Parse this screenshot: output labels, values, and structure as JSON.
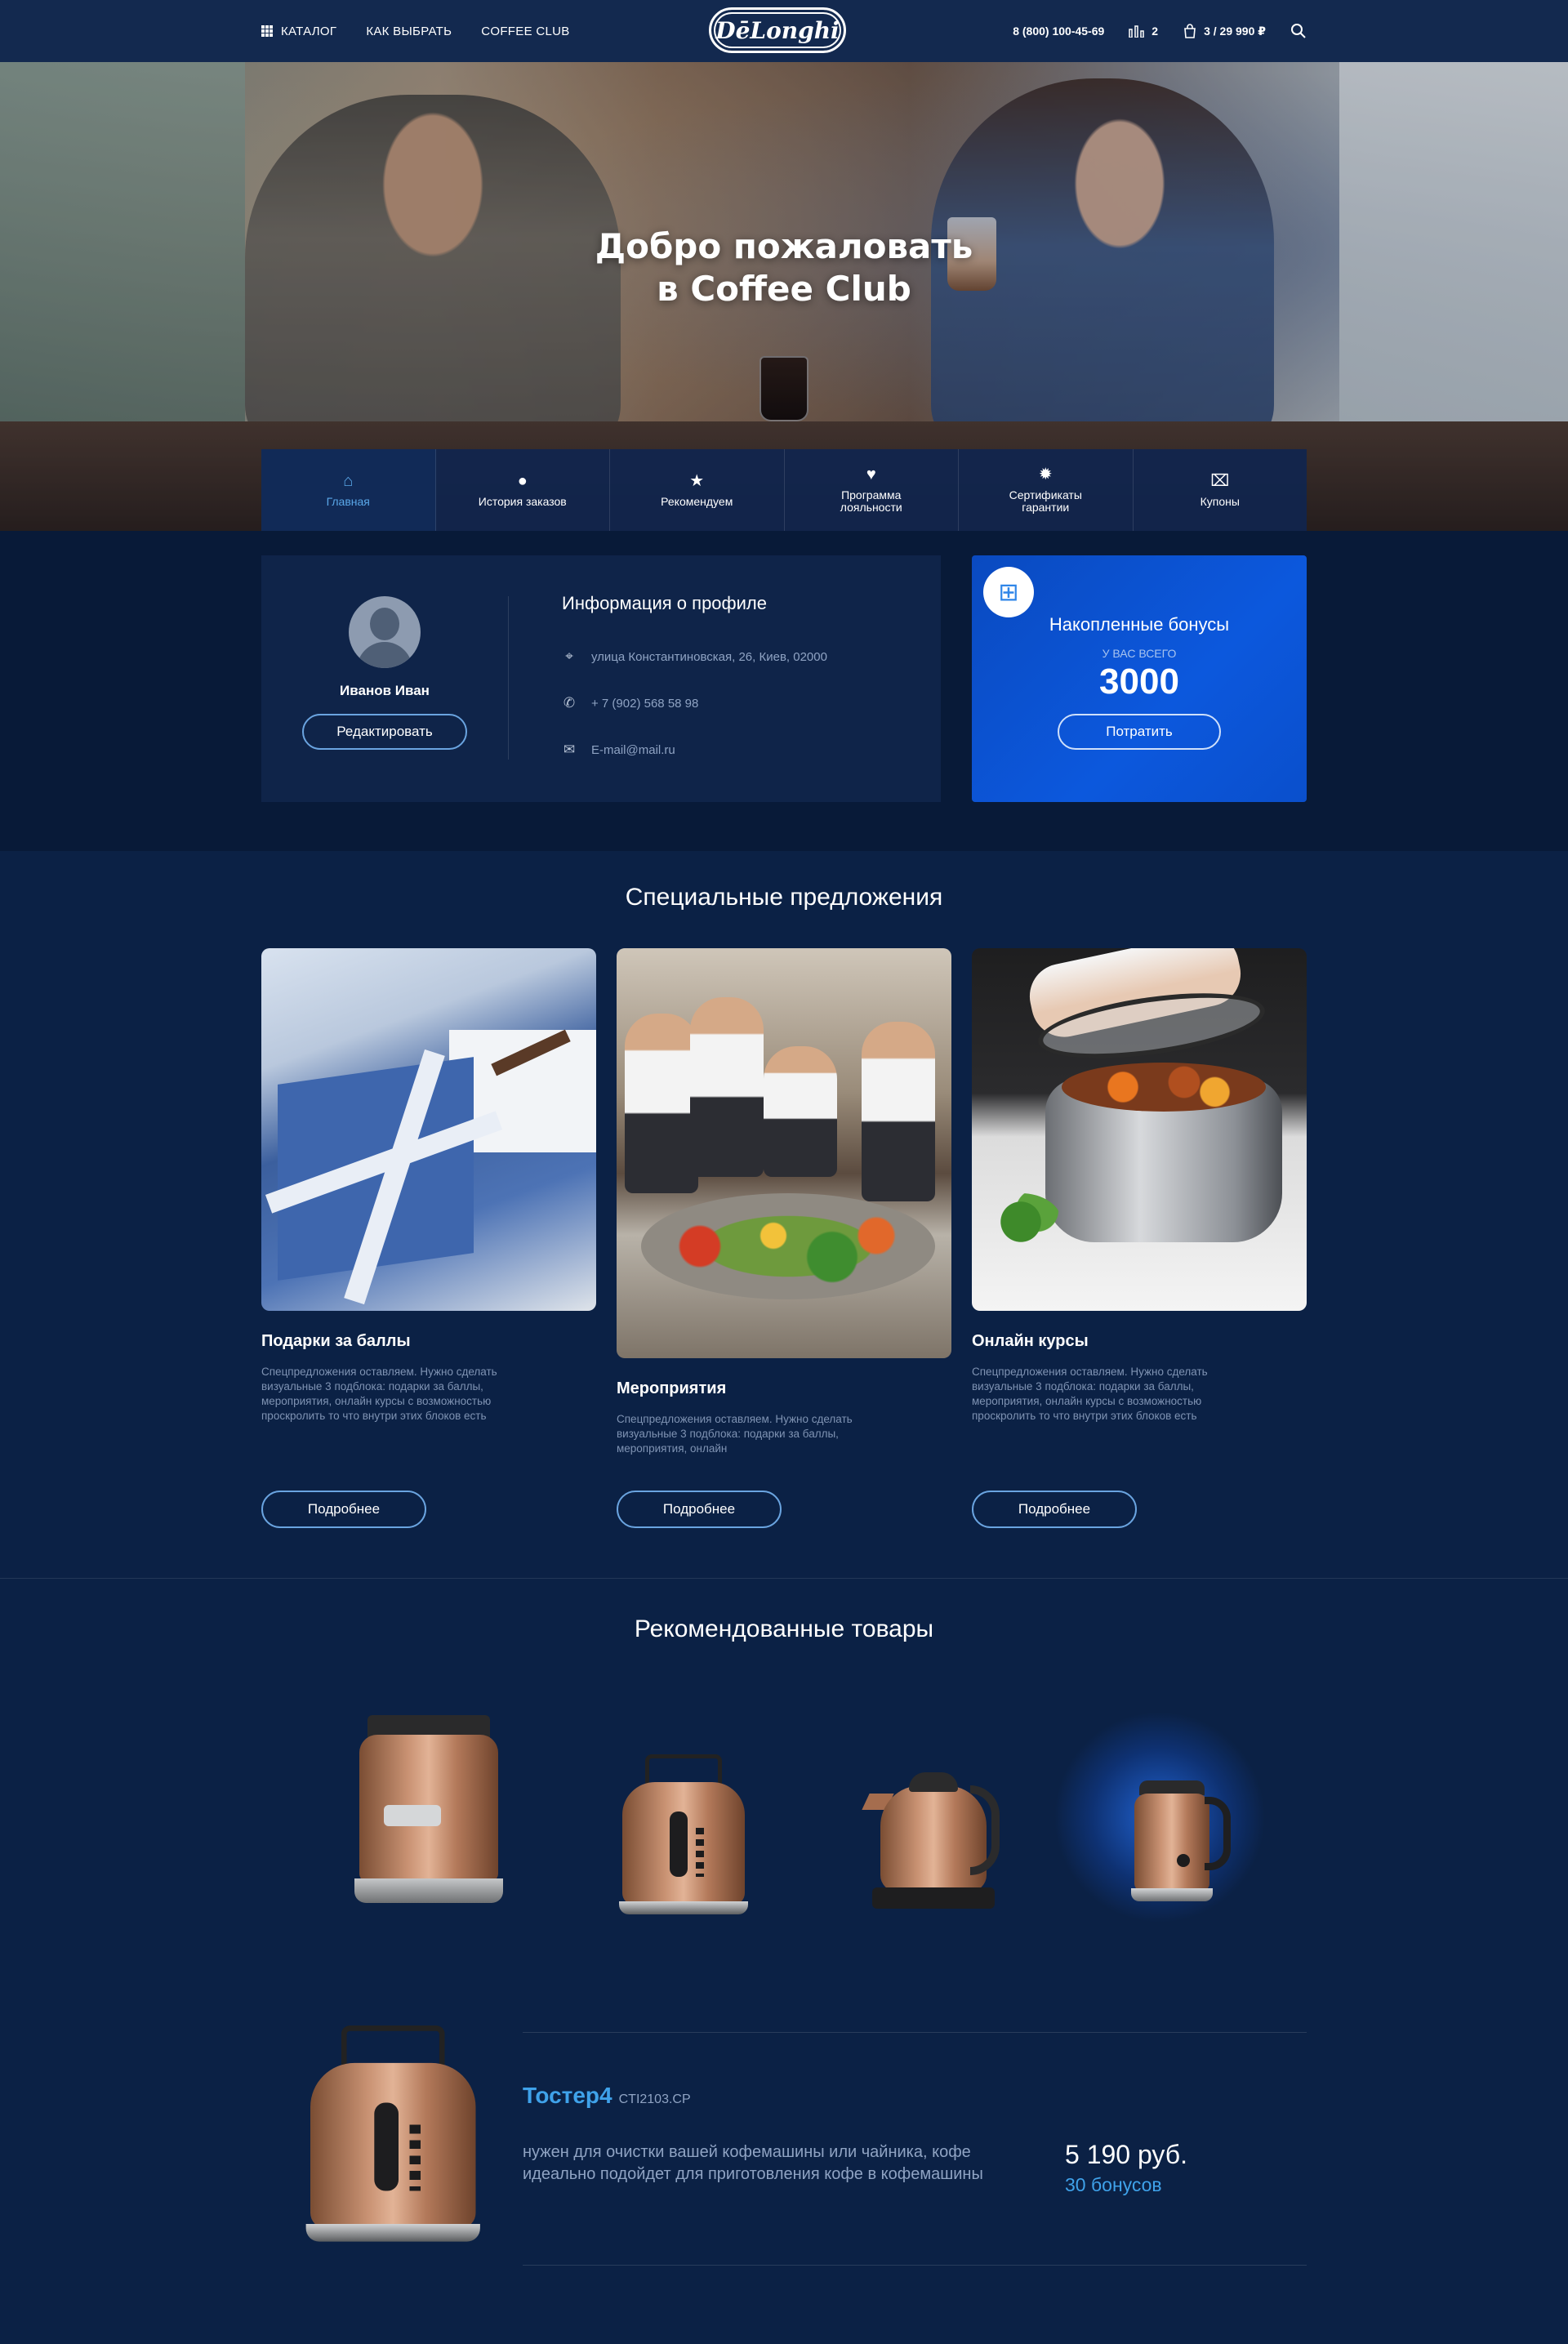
{
  "header": {
    "nav": [
      "КАТАЛОГ",
      "КАК ВЫБРАТЬ",
      "COFFEE CLUB"
    ],
    "logo": "DēLonghi",
    "phone": "8 (800) 100-45-69",
    "compare_count": "2",
    "cart": "3 / 29 990 ₽"
  },
  "hero": {
    "title_line1": "Добро пожаловать",
    "title_line2": "в Coffee Club"
  },
  "tabs": [
    {
      "label": "Главная",
      "icon": "home-icon",
      "active": true
    },
    {
      "label": "История заказов",
      "icon": "clock-icon"
    },
    {
      "label": "Рекомендуем",
      "icon": "star-icon"
    },
    {
      "label": "Программа лояльности",
      "icon": "heart-icon"
    },
    {
      "label": "Сертификаты гарантии",
      "icon": "certificate-icon"
    },
    {
      "label": "Купоны",
      "icon": "coupon-icon"
    }
  ],
  "profile": {
    "name": "Иванов Иван",
    "edit_button": "Редактировать",
    "info_title": "Информация о профиле",
    "address": "улица Константиновская, 26, Киев, 02000",
    "phone": "+ 7 (902) 568 58 98",
    "email": "E-mail@mail.ru"
  },
  "bonus": {
    "title": "Накопленные бонусы",
    "subtitle": "У ВАС ВСЕГО",
    "value": "3000",
    "spend_button": "Потратить"
  },
  "offers": {
    "title": "Специальные предложения",
    "items": [
      {
        "title": "Подарки за баллы",
        "text": "Спецпредложения оставляем. Нужно сделать визуальные 3 подблока: подарки за баллы, мероприятия, онлайн курсы с возможностью проскролить то что внутри этих блоков есть",
        "button": "Подробнее"
      },
      {
        "title": "Мероприятия",
        "text": "Спецпредложения оставляем. Нужно сделать визуальные 3 подблока: подарки за баллы, мероприятия, онлайн",
        "button": "Подробнее"
      },
      {
        "title": "Онлайн курсы",
        "text": "Спецпредложения оставляем. Нужно сделать визуальные 3 подблока: подарки за баллы, мероприятия, онлайн курсы с возможностью проскролить то что внутри этих блоков есть",
        "button": "Подробнее"
      }
    ]
  },
  "recommended": {
    "title": "Рекомендованные товары",
    "products": [
      "espresso-machine",
      "toaster",
      "kettle",
      "milk-frother"
    ],
    "selected": {
      "name": "Тостер4",
      "sku": "CTI2103.CP",
      "description": "нужен для очистки вашей кофемашины или чайника, кофе идеально подойдет для приготовления кофе в кофемашины",
      "price": "5 190 руб.",
      "bonus": "30 бонусов"
    }
  },
  "colors": {
    "bg": "#0b2145",
    "accent": "#3fa2ea",
    "bonus_card": "#0c58dd"
  }
}
